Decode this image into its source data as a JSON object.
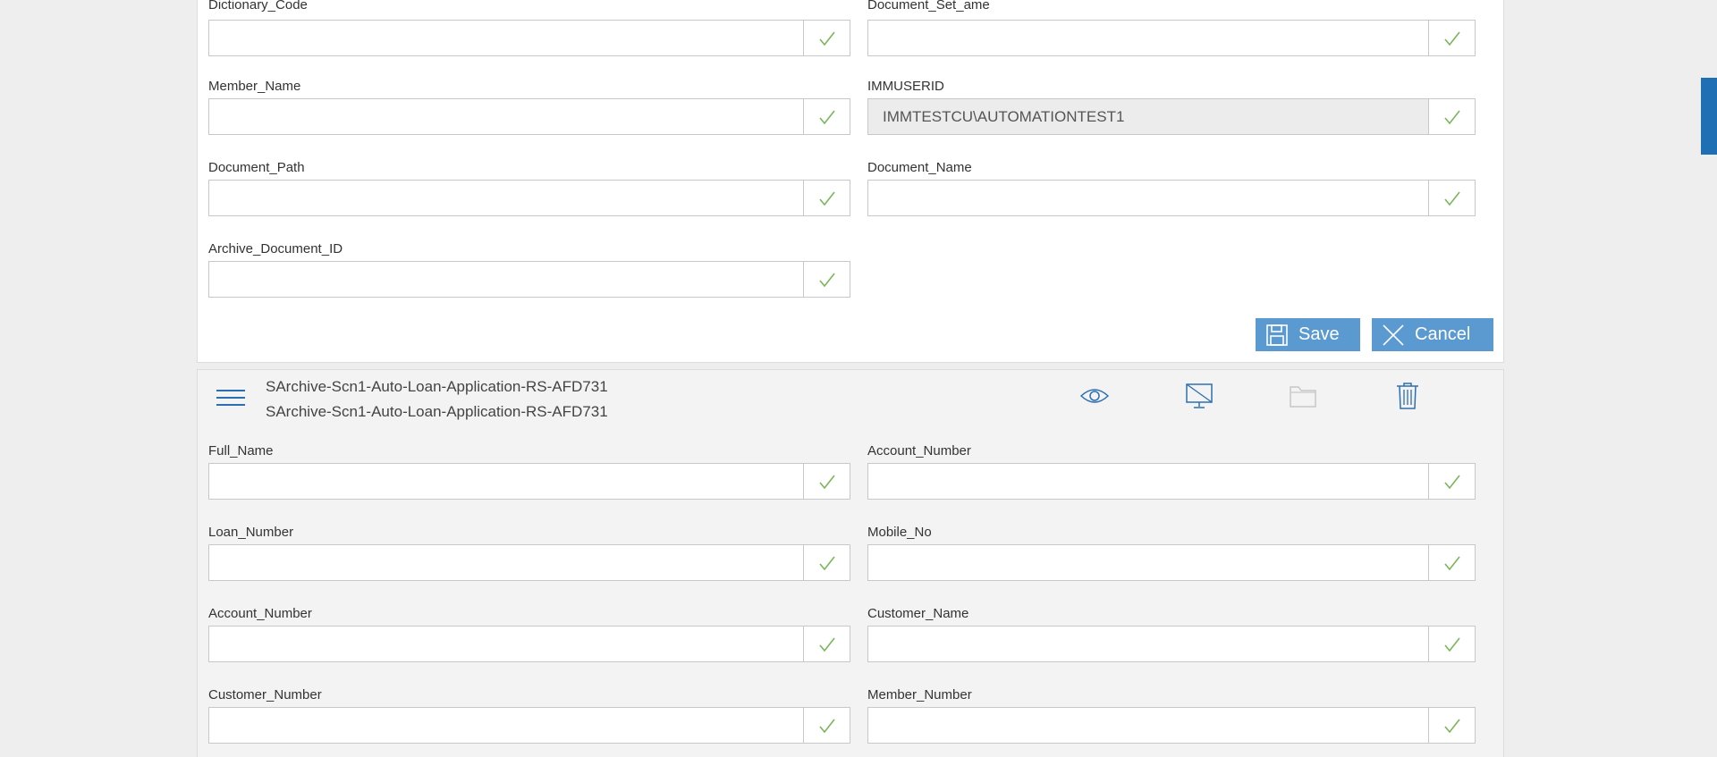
{
  "top_form": {
    "fields": [
      {
        "label": "Dictionary_Code",
        "value": ""
      },
      {
        "label": "Document_Set_ame",
        "value": ""
      },
      {
        "label": "Member_Name",
        "value": ""
      },
      {
        "label": "IMMUSERID",
        "value": "IMMTESTCU\\AUTOMATIONTEST1"
      },
      {
        "label": "Document_Path",
        "value": ""
      },
      {
        "label": "Document_Name",
        "value": ""
      },
      {
        "label": "Archive_Document_ID",
        "value": ""
      }
    ],
    "save_label": "Save",
    "cancel_label": "Cancel"
  },
  "document": {
    "title_line1": "SArchive-Scn1-Auto-Loan-Application-RS-AFD731",
    "title_line2": "SArchive-Scn1-Auto-Loan-Application-RS-AFD731",
    "toolbar_icons": [
      "view-icon",
      "monitor-icon",
      "folder-icon",
      "trash-icon"
    ],
    "fields": [
      {
        "label": "Full_Name",
        "value": ""
      },
      {
        "label": "Account_Number",
        "value": ""
      },
      {
        "label": "Loan_Number",
        "value": ""
      },
      {
        "label": "Mobile_No",
        "value": ""
      },
      {
        "label": "Account_Number",
        "value": ""
      },
      {
        "label": "Customer_Name",
        "value": ""
      },
      {
        "label": "Customer_Number",
        "value": ""
      },
      {
        "label": "Member_Number",
        "value": ""
      }
    ]
  },
  "colors": {
    "accent": "#5b9ad0",
    "check": "#7ab55c",
    "side_tab": "#1f6fb5"
  }
}
